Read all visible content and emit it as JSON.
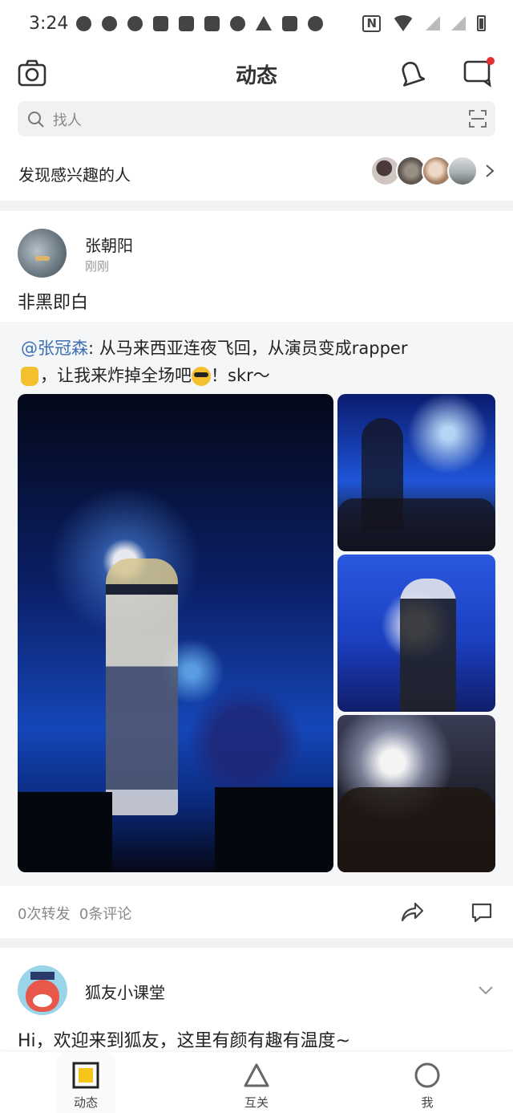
{
  "status_bar": {
    "time": "3:24",
    "nfc": "N"
  },
  "header": {
    "title": "动态"
  },
  "search": {
    "placeholder": "找人"
  },
  "discover": {
    "label": "发现感兴趣的人"
  },
  "post": {
    "author": "张朝阳",
    "time": "刚刚",
    "text": "非黑即白",
    "repost": {
      "mention": "@张冠森",
      "text_part1": ": 从马来西亚连夜飞回，从演员变成rapper",
      "text_part2": "，让我来炸掉全场吧",
      "text_part3": "！skr～"
    },
    "stats": {
      "reposts": "0次转发",
      "comments": "0条评论"
    }
  },
  "post2": {
    "author": "狐友小课堂",
    "text": "Hi，欢迎来到狐友，这里有颜有趣有温度~"
  },
  "bottom_nav": {
    "items": [
      {
        "label": "动态"
      },
      {
        "label": "互关"
      },
      {
        "label": "我"
      }
    ]
  },
  "colors": {
    "mention": "#3c6fb4",
    "accent": "#f5c518",
    "notification_dot": "#e62f2f"
  }
}
